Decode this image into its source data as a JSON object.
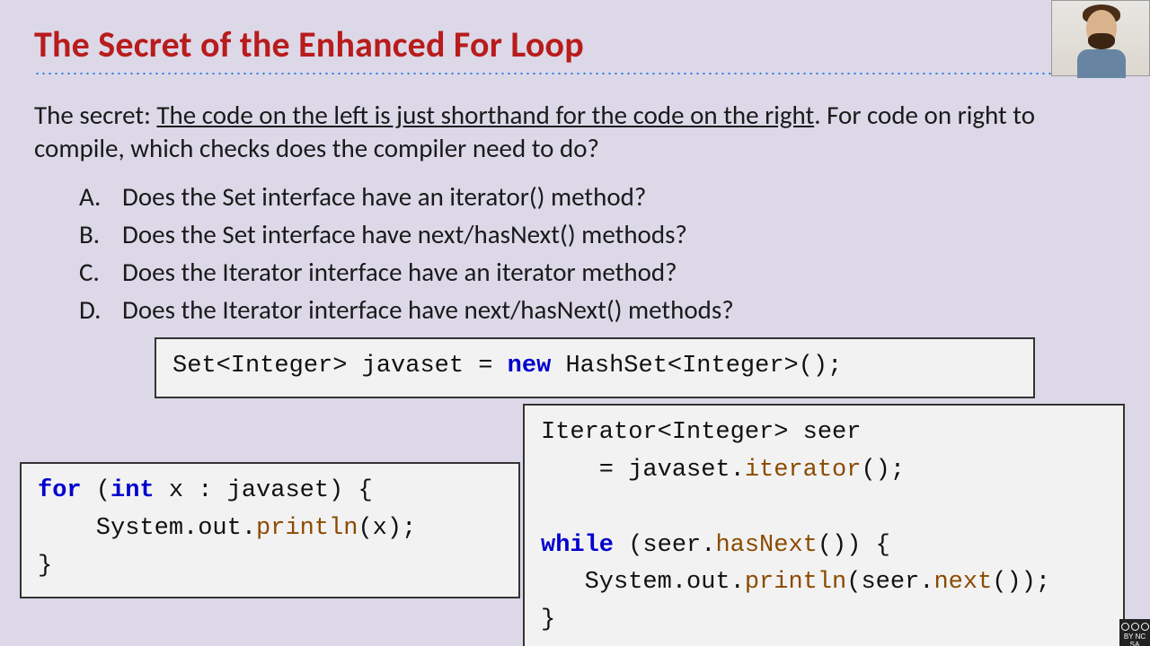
{
  "title": "The Secret of the Enhanced For Loop",
  "intro_pre": "The secret: ",
  "intro_underlined": "The code on the left is just shorthand for the code on the right",
  "intro_post": ". For code on right to compile, which checks does the compiler need to do?",
  "options": [
    {
      "letter": "A.",
      "text": "Does the Set interface have an iterator() method?"
    },
    {
      "letter": "B.",
      "text": "Does the Set interface have next/hasNext() methods?"
    },
    {
      "letter": "C.",
      "text": "Does the Iterator interface have an iterator method?"
    },
    {
      "letter": "D.",
      "text": "Does the Iterator interface have next/hasNext() methods?"
    }
  ],
  "code_top": {
    "t1": "Set<Integer> javaset = ",
    "kw_new": "new",
    "t2": " HashSet<Integer>();"
  },
  "code_left": {
    "kw_for": "for",
    "l1a": " (",
    "kw_int": "int",
    "l1b": " x : javaset) {",
    "l2a": "    System.out.",
    "call_println": "println",
    "l2b": "(x);",
    "l3": "}"
  },
  "code_right": {
    "r1": "Iterator<Integer> seer",
    "r2a": "    = javaset.",
    "call_iterator": "iterator",
    "r2b": "();",
    "blank": "",
    "kw_while": "while",
    "r3a": " (seer.",
    "call_hasNext": "hasNext",
    "r3b": "()) {",
    "r4a": "   System.out.",
    "call_println": "println",
    "r4b": "(seer.",
    "call_next": "next",
    "r4c": "());",
    "r5": "}"
  },
  "cc_label": "BY NC SA"
}
